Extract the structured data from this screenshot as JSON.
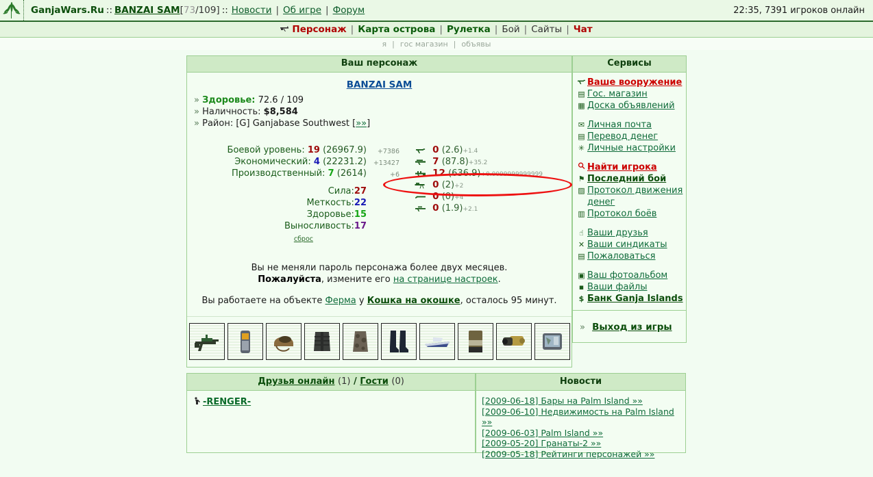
{
  "topbar": {
    "logo_icon": "cannabis-leaf-icon",
    "site": "GanjaWars.Ru",
    "sep1": "::",
    "user": "BANZAI SAM",
    "hp_open": "[",
    "hp_current": "73",
    "hp_slash": "/",
    "hp_max": "109]",
    "sep2": "::",
    "links": [
      "Новости",
      "Об игре",
      "Форум"
    ],
    "status": "22:35, 7391 игроков онлайн"
  },
  "menu": {
    "icon": "rifle-icon",
    "items": [
      {
        "label": "Персонаж",
        "style": "red"
      },
      {
        "label": "Карта острова",
        "style": "green"
      },
      {
        "label": "Рулетка",
        "style": "green"
      },
      {
        "label": "Бой",
        "style": "plain"
      },
      {
        "label": "Сайты",
        "style": "plain"
      },
      {
        "label": "Чат",
        "style": "red"
      }
    ],
    "sub_items": [
      "я",
      "гос магазин",
      "объявы"
    ]
  },
  "character": {
    "panel_title": "Ваш персонаж",
    "name": "BANZAI SAM",
    "health_label": "Здоровье:",
    "health_value": "72.6 / 109",
    "cash_label": "Наличность:",
    "cash_value": "$8,584",
    "district_label": "Район:",
    "district_value": "[G] Ganjabase Southwest",
    "district_link": "»»",
    "bullet": "»"
  },
  "stats": {
    "levels": [
      {
        "name": "Боевой уровень:",
        "value": "19",
        "color": "red",
        "exp": "(26967.9)",
        "delta": "+7386"
      },
      {
        "name": "Экономический:",
        "value": "4",
        "color": "blue",
        "exp": "(22231.2)",
        "delta": "+13427"
      },
      {
        "name": "Производственный:",
        "value": "7",
        "color": "green",
        "exp": "(2614)",
        "delta": "+6"
      }
    ],
    "attributes": [
      {
        "name": "Сила:",
        "value": "27",
        "color": "red"
      },
      {
        "name": "Меткость:",
        "value": "22",
        "color": "blue"
      },
      {
        "name": "Здоровье:",
        "value": "15",
        "color": "green"
      },
      {
        "name": "Выносливость:",
        "value": "17",
        "color": "purple"
      }
    ],
    "reset_label": "сброс"
  },
  "skills": [
    {
      "icon": "pistol-icon",
      "value": "0",
      "base": "(2.6)",
      "add": "+1.4",
      "highlighted": false
    },
    {
      "icon": "smg-icon",
      "value": "7",
      "base": "(87.8)",
      "add": "+35.2",
      "highlighted": false
    },
    {
      "icon": "assault-rifle-icon",
      "value": "12",
      "base": "(636.9)",
      "add": "+0.0099999999999",
      "highlighted": true
    },
    {
      "icon": "machine-gun-icon",
      "value": "0",
      "base": "(2)",
      "add": "+2",
      "highlighted": false
    },
    {
      "icon": "shotgun-icon",
      "value": "0",
      "base": "(0)",
      "add": "+4",
      "highlighted": false
    },
    {
      "icon": "sniper-rifle-icon",
      "value": "0",
      "base": "(1.9)",
      "add": "+2.1",
      "highlighted": false
    }
  ],
  "notice": {
    "line1": "Вы не меняли пароль персонажа более двух месяцев.",
    "line2_bold": "Пожалуйста",
    "line2_mid": ", измените его ",
    "line2_link": "на странице настроек",
    "line2_end": ".",
    "work_pre": "Вы работаете на объекте ",
    "work_object": "Ферма",
    "work_mid": " у ",
    "work_owner": "Кошка на окошке",
    "work_post": ", осталось 95 минут."
  },
  "inventory": [
    {
      "name": "assault-rifle-item"
    },
    {
      "name": "mobile-phone-item"
    },
    {
      "name": "helmet-item"
    },
    {
      "name": "body-armor-vest-item"
    },
    {
      "name": "camo-jacket-item"
    },
    {
      "name": "boots-item"
    },
    {
      "name": "speedboat-item"
    },
    {
      "name": "backpack-item"
    },
    {
      "name": "binoculars-item"
    },
    {
      "name": "gps-navigator-item"
    }
  ],
  "services": {
    "panel_title": "Сервисы",
    "groups": [
      [
        {
          "icon": "pistol-icon",
          "label": "Ваше вооружение",
          "style": "red"
        },
        {
          "icon": "calculator-icon",
          "label": "Гос. магазин",
          "style": "normal"
        },
        {
          "icon": "board-icon",
          "label": "Доска объявлений",
          "style": "normal"
        }
      ],
      [
        {
          "icon": "envelope-icon",
          "label": "Личная почта",
          "style": "normal"
        },
        {
          "icon": "money-transfer-icon",
          "label": "Перевод денег",
          "style": "normal"
        },
        {
          "icon": "settings-icon",
          "label": "Личные настройки",
          "style": "normal"
        }
      ],
      [
        {
          "icon": "magnifier-icon",
          "label": "Найти игрока",
          "style": "red"
        },
        {
          "icon": "fight-icon",
          "label": "Последний бой",
          "style": "bold"
        },
        {
          "icon": "chart-icon",
          "label": "Протокол движения денег",
          "style": "normal"
        },
        {
          "icon": "log-icon",
          "label": "Протокол боёв",
          "style": "normal"
        }
      ],
      [
        {
          "icon": "handshake-icon",
          "label": "Ваши друзья",
          "style": "normal"
        },
        {
          "icon": "syndicate-icon",
          "label": "Ваши синдикаты",
          "style": "normal"
        },
        {
          "icon": "document-icon",
          "label": "Пожаловаться",
          "style": "normal"
        }
      ],
      [
        {
          "icon": "photo-icon",
          "label": "Ваш фотоальбом",
          "style": "normal"
        },
        {
          "icon": "floppy-icon",
          "label": "Ваши файлы",
          "style": "normal"
        },
        {
          "icon": "dollar-icon",
          "label": "Банк Ganja Islands",
          "style": "bold"
        }
      ]
    ],
    "logout_bullet": "»",
    "logout_label": "Выход из игры"
  },
  "friends": {
    "title_link": "Друзья онлайн",
    "title_count": "(1)",
    "title_sep": "/",
    "guests_link": "Гости",
    "guests_count": "(0)",
    "rows": [
      {
        "icon": "soldier-icon",
        "name": "-RENGER-"
      }
    ]
  },
  "news": {
    "title": "Новости",
    "items": [
      "[2009-06-18] Бары на Palm Island »»",
      "[2009-06-10] Недвижимость на Palm Island »»",
      "[2009-06-03] Palm Island »»",
      "[2009-05-20] Гранаты-2 »»",
      "[2009-05-18] Рейтинги персонажей »»"
    ]
  },
  "colors": {
    "accent_red": "#cc0000",
    "accent_green": "#0b4d0b",
    "panel_header_bg": "#cfeac6",
    "page_bg": "#f2fcf2",
    "highlight_ellipse": "#ee1111"
  }
}
